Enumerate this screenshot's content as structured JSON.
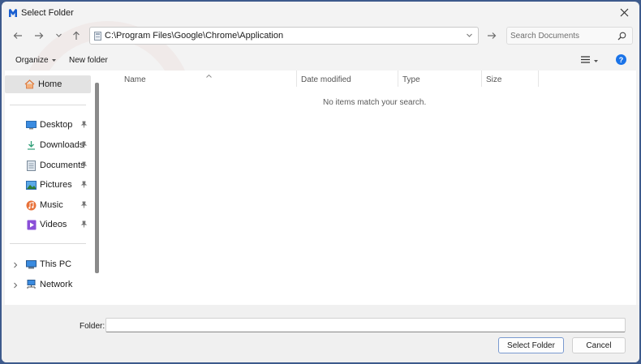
{
  "window": {
    "title": "Select Folder"
  },
  "address_bar": {
    "path": "C:\\Program Files\\Google\\Chrome\\Application"
  },
  "search": {
    "placeholder": "Search Documents"
  },
  "toolbar": {
    "organize_label": "Organize",
    "new_folder_label": "New folder",
    "help_label": "?"
  },
  "sidebar": {
    "home": {
      "label": "Home"
    },
    "quick_access": [
      {
        "label": "Desktop",
        "icon": "desktop-icon",
        "pinned": true
      },
      {
        "label": "Downloads",
        "icon": "downloads-icon",
        "pinned": true
      },
      {
        "label": "Documents",
        "icon": "documents-icon",
        "pinned": true
      },
      {
        "label": "Pictures",
        "icon": "pictures-icon",
        "pinned": true
      },
      {
        "label": "Music",
        "icon": "music-icon",
        "pinned": true
      },
      {
        "label": "Videos",
        "icon": "videos-icon",
        "pinned": true
      }
    ],
    "locations": [
      {
        "label": "This PC",
        "icon": "computer-icon"
      },
      {
        "label": "Network",
        "icon": "network-icon"
      }
    ]
  },
  "file_list": {
    "columns": [
      "Name",
      "Date modified",
      "Type",
      "Size"
    ],
    "empty_message": "No items match your search."
  },
  "footer": {
    "folder_label": "Folder:",
    "folder_value": "",
    "select_button_label": "Select Folder",
    "cancel_button_label": "Cancel"
  },
  "colors": {
    "accent": "#1a73e8",
    "frame": "#3d5a8c"
  }
}
